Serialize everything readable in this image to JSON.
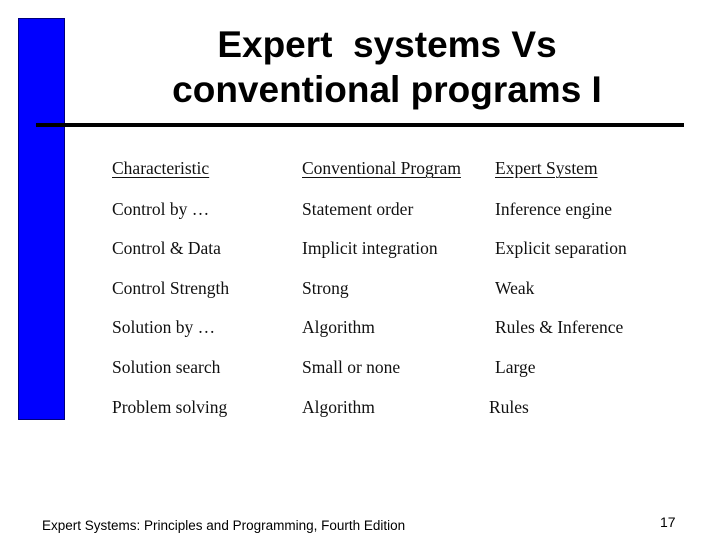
{
  "slide": {
    "title_lines": [
      "Expert  systems Vs",
      "conventional programs I"
    ],
    "accent_color": "#0000FF"
  },
  "table": {
    "headers": [
      "Characteristic",
      "Conventional Program",
      "Expert System"
    ],
    "rows": [
      [
        "Control by …",
        "Statement order",
        "Inference engine"
      ],
      [
        "Control & Data",
        "Implicit integration",
        "Explicit separation"
      ],
      [
        "Control Strength",
        "Strong",
        "Weak"
      ],
      [
        "Solution by …",
        "Algorithm",
        "Rules & Inference"
      ],
      [
        "Solution search",
        "Small or none",
        "Large"
      ],
      [
        "Problem solving",
        "Algorithm",
        "Rules"
      ]
    ]
  },
  "footer": {
    "text": "Expert Systems: Principles and Programming, Fourth Edition",
    "page_number": "17"
  }
}
